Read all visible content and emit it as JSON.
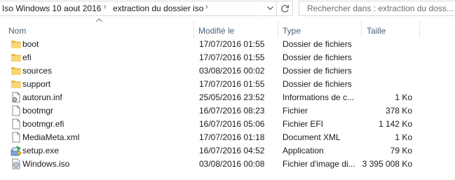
{
  "address_bar": {
    "breadcrumbs": [
      "Iso Windows 10 aout 2016",
      "extraction du dossier iso"
    ]
  },
  "search": {
    "placeholder": "Rechercher dans : extraction du doss..."
  },
  "columns": {
    "name": "Nom",
    "modified": "Modifié le",
    "type": "Type",
    "size": "Taille"
  },
  "files": [
    {
      "name": "boot",
      "modified": "17/07/2016 01:55",
      "type": "Dossier de fichiers",
      "size": "",
      "icon": "folder-icon"
    },
    {
      "name": "efi",
      "modified": "17/07/2016 01:55",
      "type": "Dossier de fichiers",
      "size": "",
      "icon": "folder-icon"
    },
    {
      "name": "sources",
      "modified": "03/08/2016 00:02",
      "type": "Dossier de fichiers",
      "size": "",
      "icon": "folder-icon"
    },
    {
      "name": "support",
      "modified": "17/07/2016 01:55",
      "type": "Dossier de fichiers",
      "size": "",
      "icon": "folder-icon"
    },
    {
      "name": "autorun.inf",
      "modified": "25/05/2016 23:52",
      "type": "Informations de c...",
      "size": "1 Ko",
      "icon": "settings-file-icon"
    },
    {
      "name": "bootmgr",
      "modified": "16/07/2016 08:23",
      "type": "Fichier",
      "size": "378 Ko",
      "icon": "blank-file-icon"
    },
    {
      "name": "bootmgr.efi",
      "modified": "16/07/2016 05:06",
      "type": "Fichier EFI",
      "size": "1 142 Ko",
      "icon": "blank-file-icon"
    },
    {
      "name": "MediaMeta.xml",
      "modified": "17/07/2016 01:18",
      "type": "Document XML",
      "size": "1 Ko",
      "icon": "blank-file-icon"
    },
    {
      "name": "setup.exe",
      "modified": "16/07/2016 04:52",
      "type": "Application",
      "size": "79 Ko",
      "icon": "setup-exe-icon"
    },
    {
      "name": "Windows.iso",
      "modified": "03/08/2016 00:08",
      "type": "Fichier d'image di...",
      "size": "3 395 008 Ko",
      "icon": "disc-image-icon"
    }
  ]
}
